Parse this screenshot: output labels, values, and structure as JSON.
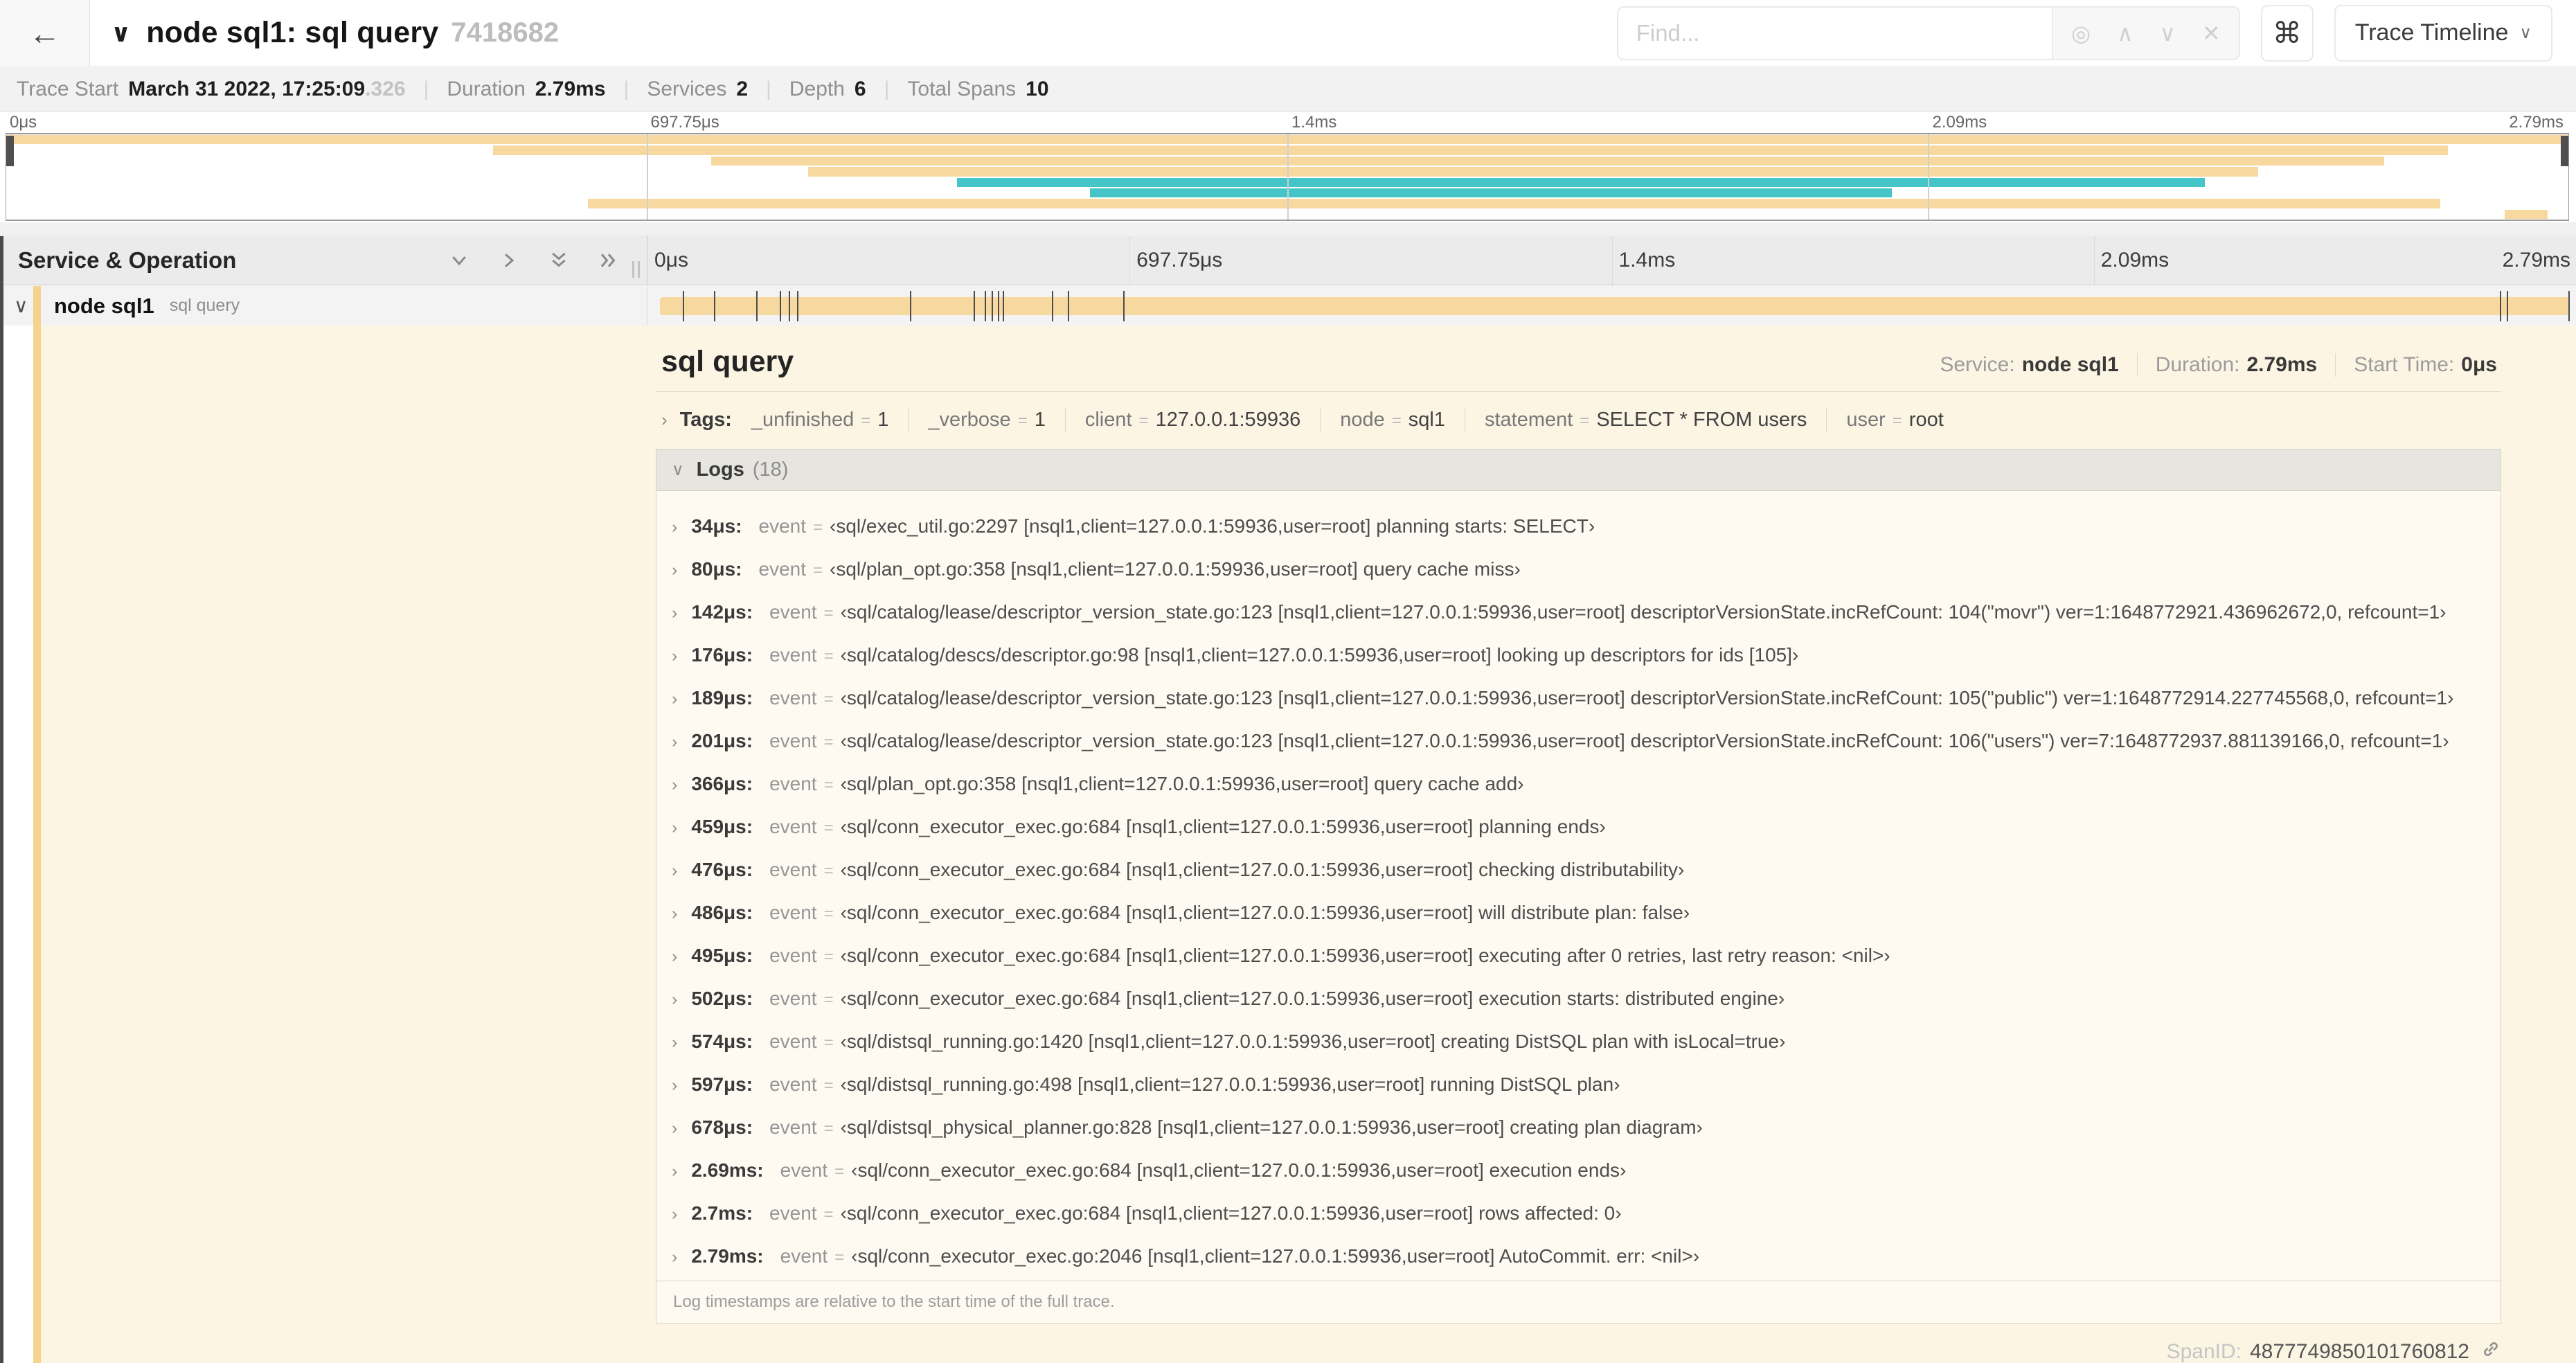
{
  "duration_us": 2790,
  "colors": {
    "tan": "#f7d9a0",
    "tan_accent": "#f5d28e",
    "teal": "#45c5c7",
    "cream": "#fcf5e4"
  },
  "header": {
    "title": "node sql1: sql query",
    "trace_id": "7418682",
    "find_placeholder": "Find...",
    "view_selector_label": "Trace Timeline"
  },
  "icons": {
    "back": "←",
    "collapse_chevron": "∨",
    "focus_match": "◎",
    "prev_match": "∧",
    "next_match": "∨",
    "clear_find": "✕",
    "keyboard_shortcut": "⌘",
    "dropdown_caret": "∨",
    "row_chevron": "∨",
    "chevron_right": "›",
    "chevron_down": "∨"
  },
  "stats": [
    {
      "label": "Trace Start",
      "value": "March 31 2022, 17:25:09",
      "suffix": ".326"
    },
    {
      "label": "Duration",
      "value": "2.79ms"
    },
    {
      "label": "Services",
      "value": "2"
    },
    {
      "label": "Depth",
      "value": "6"
    },
    {
      "label": "Total Spans",
      "value": "10"
    }
  ],
  "timeline_ticks": [
    "0μs",
    "697.75μs",
    "1.4ms",
    "2.09ms",
    "2.79ms"
  ],
  "column_header": "Service & Operation",
  "minimap_spans": [
    {
      "row": 0,
      "start": 0.0,
      "end": 1.0,
      "color": "tan"
    },
    {
      "row": 1,
      "start": 0.19,
      "end": 0.953,
      "color": "tan"
    },
    {
      "row": 2,
      "start": 0.275,
      "end": 0.928,
      "color": "tan"
    },
    {
      "row": 3,
      "start": 0.313,
      "end": 0.879,
      "color": "tan"
    },
    {
      "row": 4,
      "start": 0.371,
      "end": 0.858,
      "color": "teal"
    },
    {
      "row": 5,
      "start": 0.423,
      "end": 0.736,
      "color": "teal"
    },
    {
      "row": 6,
      "start": 0.227,
      "end": 0.95,
      "color": "tan"
    },
    {
      "row": 7,
      "start": 0.975,
      "end": 0.992,
      "color": "tan"
    }
  ],
  "span_row": {
    "service": "node sql1",
    "operation": "sql query"
  },
  "detail": {
    "title": "sql query",
    "meta": [
      {
        "label": "Service:",
        "value": "node sql1"
      },
      {
        "label": "Duration:",
        "value": "2.79ms"
      },
      {
        "label": "Start Time:",
        "value": "0μs"
      }
    ],
    "tags_label": "Tags:",
    "tags": [
      {
        "key": "_unfinished",
        "value": "1"
      },
      {
        "key": "_verbose",
        "value": "1"
      },
      {
        "key": "client",
        "value": "127.0.0.1:59936"
      },
      {
        "key": "node",
        "value": "sql1"
      },
      {
        "key": "statement",
        "value": "SELECT * FROM users"
      },
      {
        "key": "user",
        "value": "root"
      }
    ],
    "logs_label": "Logs",
    "logs_count": "(18)",
    "event_key": "event",
    "logs": [
      {
        "time": "34μs",
        "t_us": 34,
        "value": "‹sql/exec_util.go:2297 [nsql1,client=127.0.0.1:59936,user=root] planning starts: SELECT›"
      },
      {
        "time": "80μs",
        "t_us": 80,
        "value": "‹sql/plan_opt.go:358 [nsql1,client=127.0.0.1:59936,user=root] query cache miss›"
      },
      {
        "time": "142μs",
        "t_us": 142,
        "value": "‹sql/catalog/lease/descriptor_version_state.go:123 [nsql1,client=127.0.0.1:59936,user=root] descriptorVersionState.incRefCount: 104(\"movr\") ver=1:1648772921.436962672,0, refcount=1›"
      },
      {
        "time": "176μs",
        "t_us": 176,
        "value": "‹sql/catalog/descs/descriptor.go:98 [nsql1,client=127.0.0.1:59936,user=root] looking up descriptors for ids [105]›"
      },
      {
        "time": "189μs",
        "t_us": 189,
        "value": "‹sql/catalog/lease/descriptor_version_state.go:123 [nsql1,client=127.0.0.1:59936,user=root] descriptorVersionState.incRefCount: 105(\"public\") ver=1:1648772914.227745568,0, refcount=1›"
      },
      {
        "time": "201μs",
        "t_us": 201,
        "value": "‹sql/catalog/lease/descriptor_version_state.go:123 [nsql1,client=127.0.0.1:59936,user=root] descriptorVersionState.incRefCount: 106(\"users\") ver=7:1648772937.881139166,0, refcount=1›"
      },
      {
        "time": "366μs",
        "t_us": 366,
        "value": "‹sql/plan_opt.go:358 [nsql1,client=127.0.0.1:59936,user=root] query cache add›"
      },
      {
        "time": "459μs",
        "t_us": 459,
        "value": "‹sql/conn_executor_exec.go:684 [nsql1,client=127.0.0.1:59936,user=root] planning ends›"
      },
      {
        "time": "476μs",
        "t_us": 476,
        "value": "‹sql/conn_executor_exec.go:684 [nsql1,client=127.0.0.1:59936,user=root] checking distributability›"
      },
      {
        "time": "486μs",
        "t_us": 486,
        "value": "‹sql/conn_executor_exec.go:684 [nsql1,client=127.0.0.1:59936,user=root] will distribute plan: false›"
      },
      {
        "time": "495μs",
        "t_us": 495,
        "value": "‹sql/conn_executor_exec.go:684 [nsql1,client=127.0.0.1:59936,user=root] executing after 0 retries, last retry reason: <nil>›"
      },
      {
        "time": "502μs",
        "t_us": 502,
        "value": "‹sql/conn_executor_exec.go:684 [nsql1,client=127.0.0.1:59936,user=root] execution starts: distributed engine›"
      },
      {
        "time": "574μs",
        "t_us": 574,
        "value": "‹sql/distsql_running.go:1420 [nsql1,client=127.0.0.1:59936,user=root] creating DistSQL plan with isLocal=true›"
      },
      {
        "time": "597μs",
        "t_us": 597,
        "value": "‹sql/distsql_running.go:498 [nsql1,client=127.0.0.1:59936,user=root] running DistSQL plan›"
      },
      {
        "time": "678μs",
        "t_us": 678,
        "value": "‹sql/distsql_physical_planner.go:828 [nsql1,client=127.0.0.1:59936,user=root] creating plan diagram›"
      },
      {
        "time": "2.69ms",
        "t_us": 2690,
        "value": "‹sql/conn_executor_exec.go:684 [nsql1,client=127.0.0.1:59936,user=root] execution ends›"
      },
      {
        "time": "2.7ms",
        "t_us": 2700,
        "value": "‹sql/conn_executor_exec.go:684 [nsql1,client=127.0.0.1:59936,user=root] rows affected: 0›"
      },
      {
        "time": "2.79ms",
        "t_us": 2790,
        "value": "‹sql/conn_executor_exec.go:2046 [nsql1,client=127.0.0.1:59936,user=root] AutoCommit. err: <nil>›"
      }
    ],
    "note": "Log timestamps are relative to the start time of the full trace.",
    "span_id_label": "SpanID:",
    "span_id": "4877749850101760812"
  }
}
